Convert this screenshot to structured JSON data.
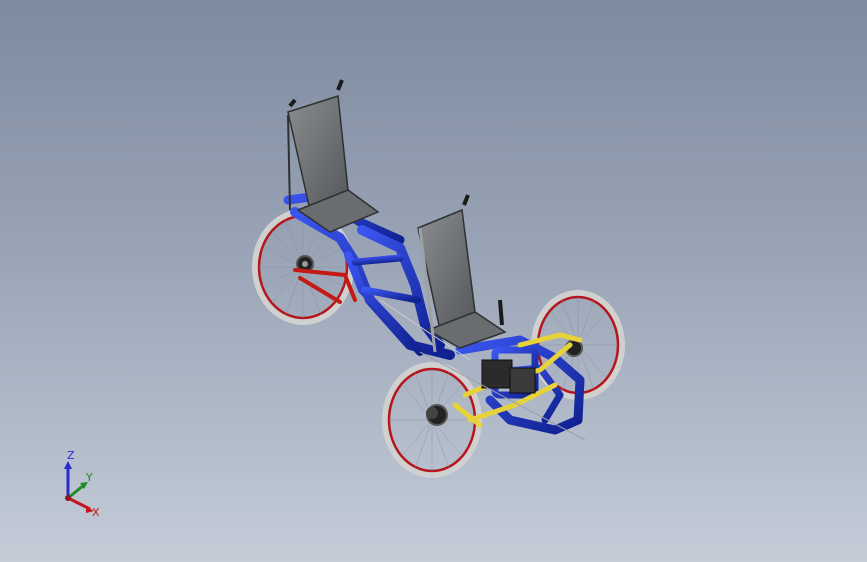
{
  "viewport": {
    "background_top": "#7e8a9f",
    "background_bottom": "#c4ccd8"
  },
  "model": {
    "frame_color": "#1c34c8",
    "subframe_color": "#e8d23a",
    "seat_color": "#6f7275",
    "tire_color": "#c9c9c9",
    "rim_color": "#b4161c",
    "linkage_color": "#c41a14"
  },
  "triad": {
    "z_label": "Z",
    "y_label": "Y",
    "x_label": "X",
    "z_color": "#2a2ad0",
    "y_color": "#1f8c2a",
    "x_color": "#c8141e"
  }
}
